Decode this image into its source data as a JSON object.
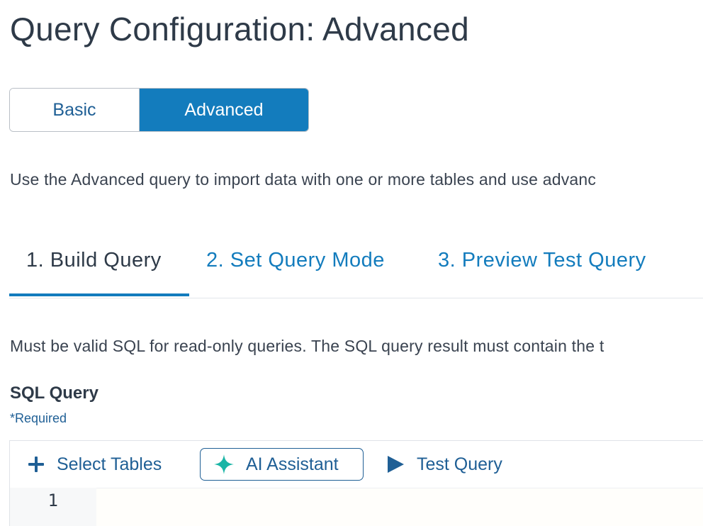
{
  "page": {
    "title": "Query Configuration: Advanced"
  },
  "mode_toggle": {
    "options": [
      {
        "label": "Basic",
        "selected": false
      },
      {
        "label": "Advanced",
        "selected": true
      }
    ]
  },
  "description": "Use the Advanced query to import data with one or more tables and use advanc",
  "steps": {
    "tabs": [
      {
        "label": "1. Build Query",
        "active": true
      },
      {
        "label": "2. Set Query Mode",
        "active": false
      },
      {
        "label": "3. Preview Test Query",
        "active": false
      }
    ]
  },
  "instructions": "Must be valid SQL for read-only queries. The SQL query result must contain the t",
  "sql_field": {
    "label": "SQL Query",
    "required_note": "*Required"
  },
  "editor": {
    "toolbar": {
      "select_tables": {
        "label": "Select Tables",
        "icon": "plus-icon"
      },
      "ai_assistant": {
        "label": "AI Assistant",
        "icon": "sparkle-icon"
      },
      "test_query": {
        "label": "Test Query",
        "icon": "play-icon"
      }
    },
    "line_numbers": [
      "1"
    ]
  },
  "colors": {
    "accent": "#137cbd",
    "link": "#1f5f95",
    "sparkle": "#1ab5a6",
    "text": "#2e3a48"
  }
}
